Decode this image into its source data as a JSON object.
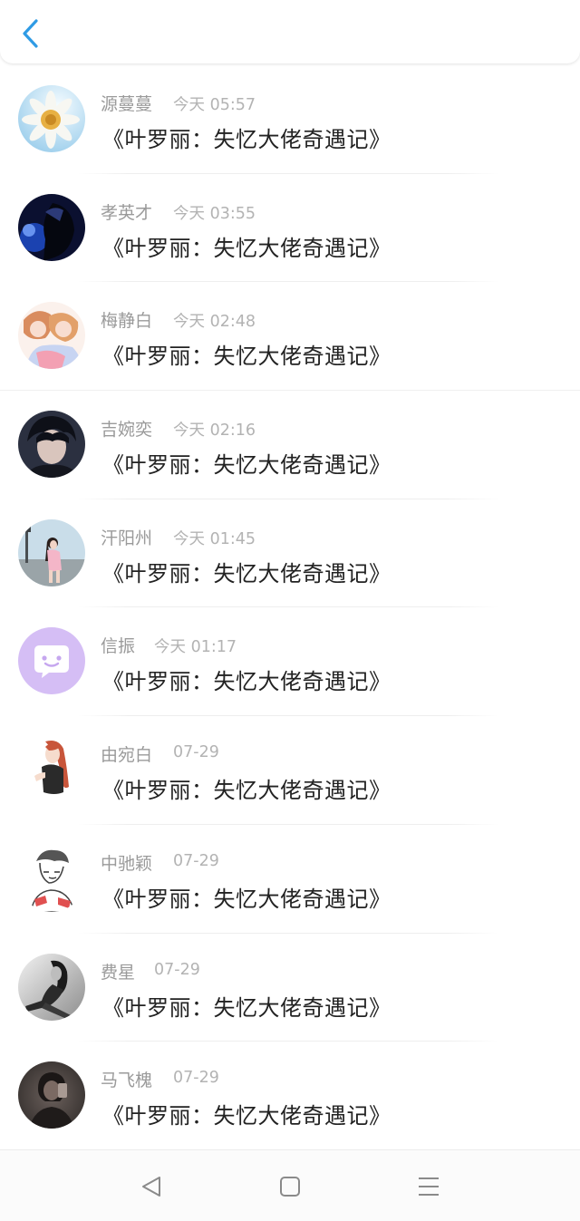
{
  "header": {
    "back_icon": "chevron-left-icon",
    "accent_color": "#2f9be5"
  },
  "messages": [
    {
      "name": "源蔓蔓",
      "time": "今天 05:57",
      "title": "《叶罗丽：失忆大佬奇遇记》"
    },
    {
      "name": "孝英才",
      "time": "今天 03:55",
      "title": "《叶罗丽：失忆大佬奇遇记》"
    },
    {
      "name": "梅静白",
      "time": "今天 02:48",
      "title": "《叶罗丽：失忆大佬奇遇记》"
    },
    {
      "name": "吉婉奕",
      "time": "今天 02:16",
      "title": "《叶罗丽：失忆大佬奇遇记》"
    },
    {
      "name": "汗阳州",
      "time": "今天 01:45",
      "title": "《叶罗丽：失忆大佬奇遇记》"
    },
    {
      "name": "信振",
      "time": "今天 01:17",
      "title": "《叶罗丽：失忆大佬奇遇记》"
    },
    {
      "name": "由宛白",
      "time": "07-29",
      "title": "《叶罗丽：失忆大佬奇遇记》"
    },
    {
      "name": "中驰颖",
      "time": "07-29",
      "title": "《叶罗丽：失忆大佬奇遇记》"
    },
    {
      "name": "费星",
      "time": "07-29",
      "title": "《叶罗丽：失忆大佬奇遇记》"
    },
    {
      "name": "马飞槐",
      "time": "07-29",
      "title": "《叶罗丽：失忆大佬奇遇记》"
    }
  ],
  "navbar": {
    "back_icon": "triangle-back-icon",
    "home_icon": "square-home-icon",
    "menu_icon": "hamburger-menu-icon"
  }
}
